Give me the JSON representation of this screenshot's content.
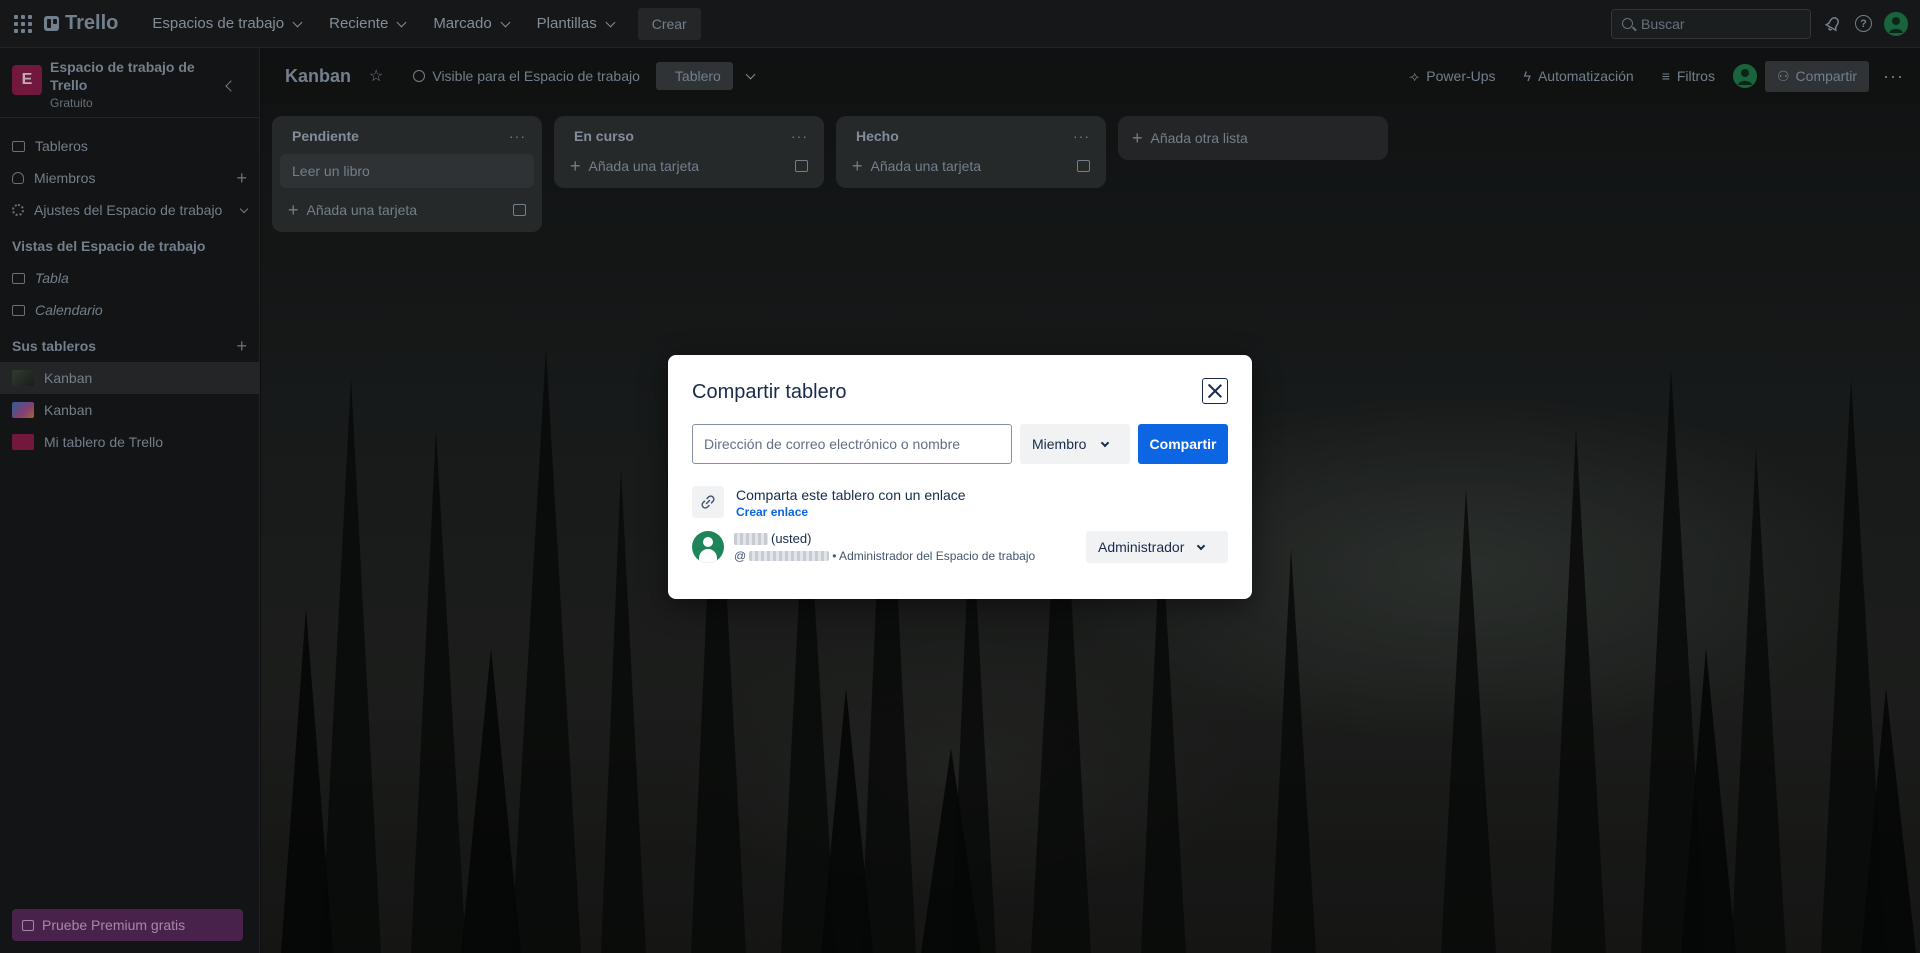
{
  "topbar": {
    "logo": "Trello",
    "nav": [
      {
        "label": "Espacios de trabajo"
      },
      {
        "label": "Reciente"
      },
      {
        "label": "Marcado"
      },
      {
        "label": "Plantillas"
      }
    ],
    "create_label": "Crear",
    "search_placeholder": "Buscar"
  },
  "sidebar": {
    "workspace_initial": "E",
    "workspace_name": "Espacio de trabajo de Trello",
    "workspace_plan": "Gratuito",
    "items": [
      {
        "label": "Tableros",
        "icon": "board-icon"
      },
      {
        "label": "Miembros",
        "icon": "person-icon"
      },
      {
        "label": "Ajustes del Espacio de trabajo",
        "icon": "gear-icon"
      }
    ],
    "views_title": "Vistas del Espacio de trabajo",
    "views": [
      {
        "label": "Tabla",
        "icon": "table-icon"
      },
      {
        "label": "Calendario",
        "icon": "calendar-icon"
      }
    ],
    "boards_title": "Sus tableros",
    "boards": [
      {
        "label": "Kanban",
        "color": "#3b4a3d"
      },
      {
        "label": "Kanban",
        "color": "#6a4fa3"
      },
      {
        "label": "Mi tablero de Trello",
        "color": "#8b1e4d"
      }
    ],
    "premium_label": "Pruebe Premium gratis"
  },
  "board": {
    "title": "Kanban",
    "visibility": "Visible para el Espacio de trabajo",
    "view_label": "Tablero",
    "powerups": "Power-Ups",
    "automation": "Automatización",
    "filters": "Filtros",
    "share": "Compartir",
    "lists": [
      {
        "title": "Pendiente",
        "cards": [
          "Leer un libro"
        ],
        "add_label": "Añada una tarjeta"
      },
      {
        "title": "En curso",
        "cards": [],
        "add_label": "Añada una tarjeta"
      },
      {
        "title": "Hecho",
        "cards": [],
        "add_label": "Añada una tarjeta"
      }
    ],
    "add_list_label": "Añada otra lista"
  },
  "modal": {
    "title": "Compartir tablero",
    "email_placeholder": "Dirección de correo electrónico o nombre",
    "role_label": "Miembro",
    "share_button": "Compartir",
    "link_text": "Comparta este tablero con un enlace",
    "link_action": "Crear enlace",
    "member": {
      "you_label": "(usted)",
      "at_prefix": "@",
      "subtitle": "• Administrador del Espacio de trabajo",
      "role": "Administrador"
    }
  },
  "colors": {
    "accent": "#0c66e4",
    "avatar": "#1f845a",
    "workspace_badge": "#8b1e4d"
  }
}
